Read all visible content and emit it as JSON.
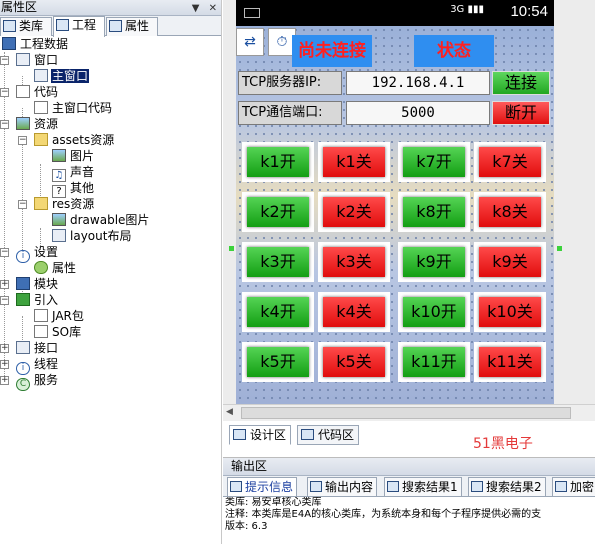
{
  "left_panel": {
    "title": "属性区",
    "title_buttons": [
      "▼",
      "✕"
    ],
    "tabs": [
      {
        "label": "类库",
        "active": false
      },
      {
        "label": "工程",
        "active": true
      },
      {
        "label": "属性",
        "active": false
      }
    ],
    "tree": [
      {
        "label": "工程数据",
        "icon": "project-icon"
      },
      {
        "label": "窗口",
        "icon": "window-icon"
      },
      {
        "label": "主窗口",
        "icon": "window-icon",
        "selected": true
      },
      {
        "label": "代码",
        "icon": "code-icon"
      },
      {
        "label": "主窗口代码",
        "icon": "code-file-icon"
      },
      {
        "label": "资源",
        "icon": "resource-icon"
      },
      {
        "label": "assets资源",
        "icon": "folder-icon"
      },
      {
        "label": "图片",
        "icon": "image-icon"
      },
      {
        "label": "声音",
        "icon": "sound-icon"
      },
      {
        "label": "其他",
        "icon": "unknown-file-icon"
      },
      {
        "label": "res资源",
        "icon": "folder-icon"
      },
      {
        "label": "drawable图片",
        "icon": "image-icon"
      },
      {
        "label": "layout布局",
        "icon": "layout-icon"
      },
      {
        "label": "设置",
        "icon": "info-icon"
      },
      {
        "label": "属性",
        "icon": "settings-icon"
      },
      {
        "label": "模块",
        "icon": "module-icon"
      },
      {
        "label": "引入",
        "icon": "import-icon"
      },
      {
        "label": "JAR包",
        "icon": "jar-icon"
      },
      {
        "label": "SO库",
        "icon": "so-icon"
      },
      {
        "label": "接口",
        "icon": "interface-icon"
      },
      {
        "label": "线程",
        "icon": "thread-icon"
      },
      {
        "label": "服务",
        "icon": "service-icon"
      }
    ]
  },
  "phone": {
    "status": {
      "time": "10:54",
      "signal": "3G"
    },
    "header": {
      "connect_status": "尚未连接",
      "state": "状态"
    },
    "tcp_ip": {
      "label": "TCP服务器IP:",
      "value": "192.168.4.1",
      "button": "连接"
    },
    "tcp_port": {
      "label": "TCP通信端口:",
      "value": "5000",
      "button": "断开"
    },
    "buttons": [
      [
        "k1开",
        "k1关",
        "k7开",
        "k7关"
      ],
      [
        "k2开",
        "k2关",
        "k8开",
        "k8关"
      ],
      [
        "k3开",
        "k3关",
        "k9开",
        "k9关"
      ],
      [
        "k4开",
        "k4关",
        "k10开",
        "k10关"
      ],
      [
        "k5开",
        "k5关",
        "k11开",
        "k11关"
      ]
    ]
  },
  "design_tabs": [
    {
      "label": "设计区",
      "active": true
    },
    {
      "label": "代码区",
      "active": false
    }
  ],
  "brand": "51黑电子",
  "output": {
    "title": "输出区",
    "tabs": [
      {
        "label": "提示信息",
        "active": true
      },
      {
        "label": "输出内容",
        "active": false
      },
      {
        "label": "搜索结果1",
        "active": false
      },
      {
        "label": "搜索结果2",
        "active": false
      },
      {
        "label": "加密",
        "active": false
      }
    ],
    "lines": [
      "类库: 易安卓核心类库",
      "注释: 本类库是E4A的核心类库，为系统本身和每个子程序提供必需的支",
      "版本: 6.3"
    ]
  },
  "colors": {
    "on_button": "#22b022",
    "off_button": "#ee1c1c",
    "header_blue": "#2f8ef0",
    "selection": "#0a246a"
  }
}
